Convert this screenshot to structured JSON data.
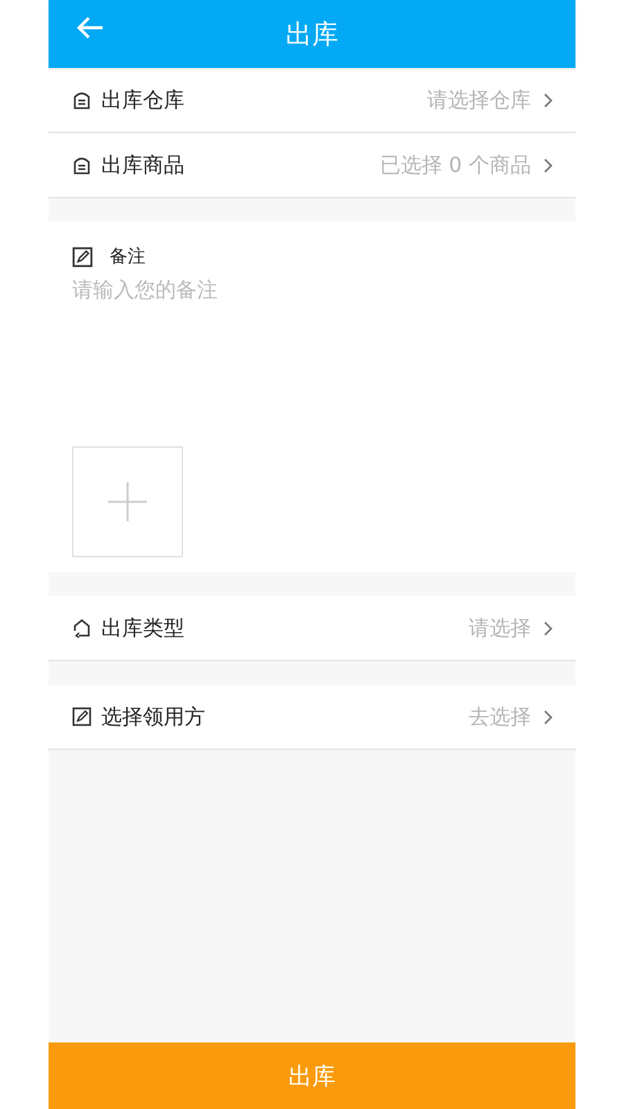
{
  "header": {
    "title": "出库"
  },
  "sections": [
    {
      "kind": "rows",
      "rows": [
        {
          "kind": "document",
          "label": "出库仓库",
          "value": "请选择仓库"
        },
        {
          "kind": "document",
          "label": "出库商品",
          "value": "已选择 0 个商品"
        }
      ]
    },
    {
      "kind": "remark",
      "label": "备注",
      "placeholder": "请输入您的备注"
    },
    {
      "kind": "rows",
      "rows": [
        {
          "kind": "return",
          "label": "出库类型",
          "value": "请选择"
        }
      ]
    },
    {
      "kind": "rows",
      "rows": [
        {
          "kind": "edit",
          "label": "选择领用方",
          "value": "去选择"
        }
      ]
    }
  ],
  "submit": {
    "label": "出库"
  }
}
